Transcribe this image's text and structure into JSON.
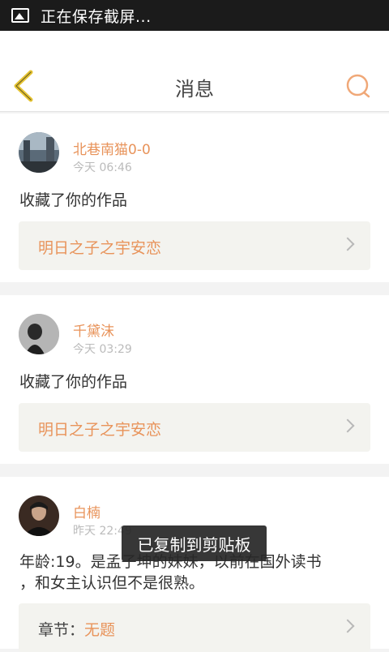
{
  "status_bar": {
    "text": "正在保存截屏..."
  },
  "header": {
    "title": "消息"
  },
  "messages": [
    {
      "user": "北巷南猫0-0",
      "time": "今天 06:46",
      "text": "收藏了你的作品",
      "work": "明日之子之宇安恋"
    },
    {
      "user": "千黛沫",
      "time": "今天 03:29",
      "text": "收藏了你的作品",
      "work": "明日之子之宇安恋"
    },
    {
      "user": "白楠",
      "time": "昨天 22:49",
      "text": "年龄:19。是孟子坤的妹妹，以前在国外读书，和女主认识但不是很熟。",
      "text_line1": "年龄:19。是孟子坤的妹妹，以前在国外读书",
      "text_line2": "，和女主认识但不是很熟。",
      "chapter_label": "章节：",
      "chapter_value": "无题"
    }
  ],
  "toast": {
    "text": "已复制到剪贴板"
  },
  "colors": {
    "accent": "#e8935a",
    "back_icon": "#e6c432",
    "search_icon": "#f0a878"
  }
}
